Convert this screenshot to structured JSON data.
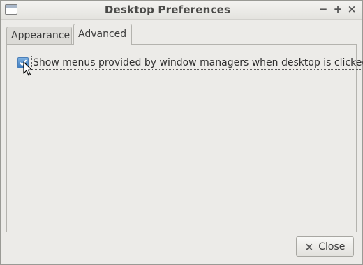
{
  "window": {
    "title": "Desktop Preferences",
    "controls": {
      "minimize": "−",
      "maximize": "+",
      "close": "×"
    }
  },
  "tabs": [
    {
      "label": "Appearance",
      "selected": false
    },
    {
      "label": "Advanced",
      "selected": true
    }
  ],
  "advanced": {
    "show_wm_menu": {
      "label": "Show menus provided by window managers when desktop is clicked",
      "checked": true
    }
  },
  "footer": {
    "close_icon": "×",
    "close_label": "Close"
  },
  "colors": {
    "accent": "#3e7cc0",
    "window_bg": "#ecebe8"
  }
}
